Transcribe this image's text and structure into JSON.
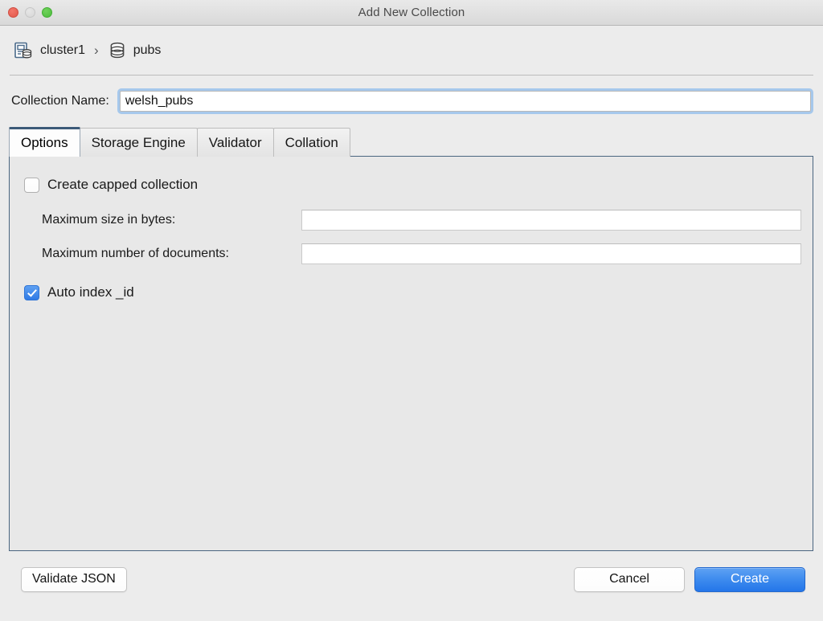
{
  "window": {
    "title": "Add New Collection",
    "controls": [
      {
        "name": "close",
        "color": "#e2584b"
      },
      {
        "name": "minimize",
        "color": "#d6d6d6"
      },
      {
        "name": "zoom",
        "color": "#4cbd3c"
      }
    ]
  },
  "breadcrumb": {
    "cluster_icon": "server-icon",
    "cluster": "cluster1",
    "separator": "›",
    "database_icon": "database-icon",
    "database": "pubs"
  },
  "collection_name": {
    "label": "Collection Name:",
    "value": "welsh_pubs",
    "placeholder": ""
  },
  "tabs": [
    {
      "label": "Options",
      "active": true
    },
    {
      "label": "Storage Engine",
      "active": false
    },
    {
      "label": "Validator",
      "active": false
    },
    {
      "label": "Collation",
      "active": false
    }
  ],
  "options": {
    "capped": {
      "label": "Create capped collection",
      "checked": false
    },
    "max_size": {
      "label": "Maximum size in bytes:",
      "value": "",
      "placeholder": ""
    },
    "max_docs": {
      "label": "Maximum number of documents:",
      "value": "",
      "placeholder": ""
    },
    "auto_index": {
      "label": "Auto index _id",
      "checked": true
    }
  },
  "footer": {
    "validate_label": "Validate JSON",
    "cancel_label": "Cancel",
    "create_label": "Create"
  },
  "colors": {
    "accent": "#2476e9",
    "panel_border": "#4a6580",
    "focus_ring": "#a6c8ec",
    "window_bg": "#ececec"
  }
}
